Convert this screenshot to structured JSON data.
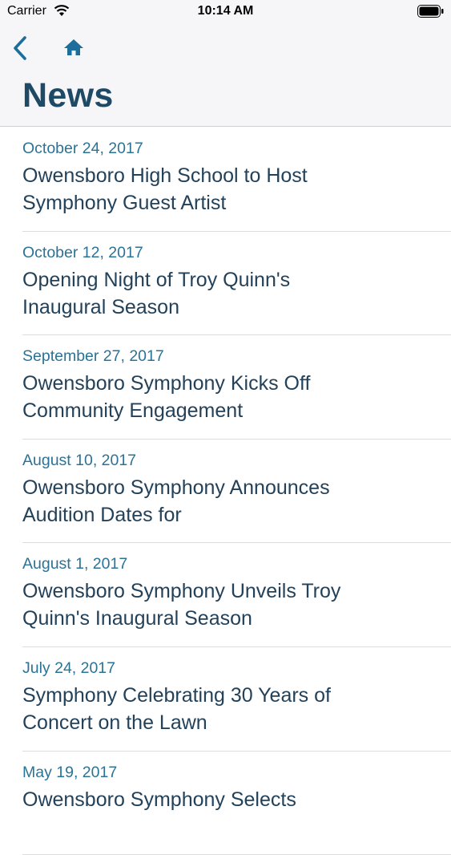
{
  "status_bar": {
    "carrier": "Carrier",
    "time": "10:14 AM"
  },
  "nav": {
    "back_icon": "chevron-left-icon",
    "home_icon": "home-icon",
    "accent_color": "#1d6e9a"
  },
  "page": {
    "title": "News"
  },
  "news": [
    {
      "date": "October 24, 2017",
      "title": "Owensboro High School to Host Symphony Guest Artist"
    },
    {
      "date": "October 12, 2017",
      "title": "Opening Night of Troy Quinn's Inaugural Season"
    },
    {
      "date": "September 27, 2017",
      "title": "Owensboro Symphony Kicks Off Community Engagement"
    },
    {
      "date": "August 10, 2017",
      "title": "Owensboro Symphony Announces Audition  Dates for"
    },
    {
      "date": "August 1, 2017",
      "title": "Owensboro Symphony Unveils Troy Quinn's Inaugural Season"
    },
    {
      "date": "July 24, 2017",
      "title": "Symphony Celebrating 30 Years of Concert on the Lawn"
    },
    {
      "date": "May 19, 2017",
      "title": "Owensboro Symphony Selects"
    }
  ]
}
